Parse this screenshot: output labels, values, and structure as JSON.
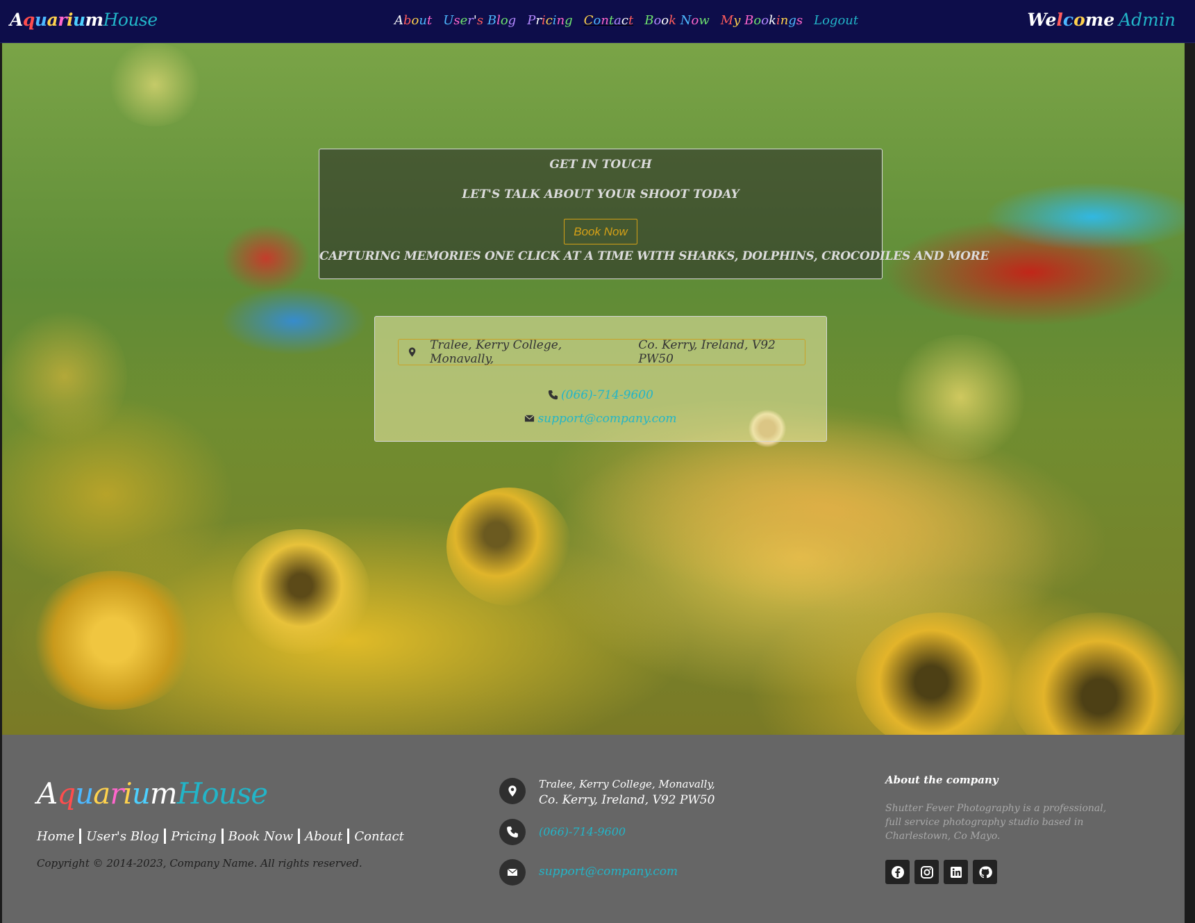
{
  "brand": {
    "letters": [
      {
        "ch": "A",
        "color": "#ffffff"
      },
      {
        "ch": "q",
        "color": "#ff4d4d"
      },
      {
        "ch": "u",
        "color": "#4db8ff"
      },
      {
        "ch": "a",
        "color": "#ffd24d"
      },
      {
        "ch": "r",
        "color": "#ff66cc"
      },
      {
        "ch": "i",
        "color": "#ffd24d"
      },
      {
        "ch": "u",
        "color": "#4dd0ff"
      },
      {
        "ch": "m",
        "color": "#ffffff"
      }
    ],
    "house": "House"
  },
  "nav": {
    "items": [
      {
        "label": "About",
        "name": "nav-about"
      },
      {
        "label": "User's Blog",
        "name": "nav-users-blog"
      },
      {
        "label": "Pricing",
        "name": "nav-pricing"
      },
      {
        "label": "Contact",
        "name": "nav-contact"
      },
      {
        "label": "Book Now",
        "name": "nav-book-now"
      },
      {
        "label": "My Bookings",
        "name": "nav-my-bookings"
      },
      {
        "label": "Logout",
        "name": "nav-logout"
      }
    ],
    "palette": [
      "#ffffff",
      "#ff5c5c",
      "#ffd24d",
      "#4db8ff",
      "#ff66cc",
      "#6fe36f",
      "#b388ff"
    ]
  },
  "welcome": {
    "word": "Welcome",
    "user": "Admin"
  },
  "hero": {
    "title": "GET IN TOUCH",
    "subtitle": "LET'S TALK ABOUT YOUR SHOOT TODAY",
    "book_label": "Book Now",
    "tagline": "CAPTURING MEMORIES ONE CLICK AT A TIME WITH SHARKS, DOLPHINS, CROCODILES AND MORE"
  },
  "contact_card": {
    "address_part1": "Tralee, Kerry College, Monavally,",
    "address_part2": "Co. Kerry, Ireland, V92 PW50",
    "phone": "(066)-714-9600",
    "email": "support@company.com"
  },
  "footer": {
    "links": [
      "Home",
      "User's Blog",
      "Pricing",
      "Book Now",
      "About",
      "Contact"
    ],
    "copyright": "Copyright © 2014-2023, Company Name. All rights reserved.",
    "address_line1": "Tralee, Kerry College, Monavally,",
    "address_line2": "Co. Kerry, Ireland, V92 PW50",
    "phone": "(066)-714-9600",
    "email": "support@company.com",
    "about_title": "About the company",
    "about_text": "Shutter Fever Photography is a professional, full service photography studio based in Charlestown, Co Mayo.",
    "socials": [
      "facebook-icon",
      "instagram-icon",
      "linkedin-icon",
      "github-icon"
    ]
  },
  "colors": {
    "navbar_bg": "#0d0d4a",
    "accent_teal": "#22b5c8",
    "gold": "#d4a017",
    "footer_bg": "#666666"
  }
}
